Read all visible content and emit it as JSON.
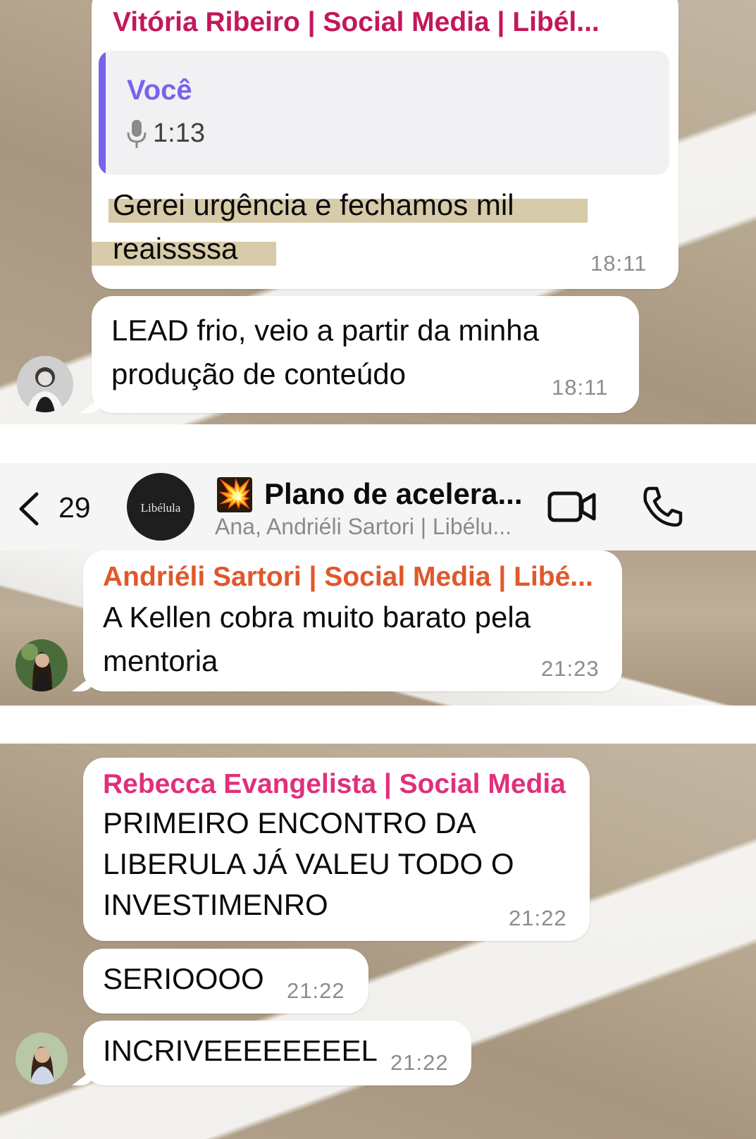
{
  "chat1": {
    "sender": "Vitória Ribeiro | Social Media | Libél...",
    "sender_color": "#c2185b",
    "reply": {
      "author": "Você",
      "author_color": "#7a63ea",
      "duration": "1:13",
      "icon": "microphone-icon"
    },
    "message": "Gerei urgência e fechamos mil\nreaissssa",
    "time": "18:11",
    "message2": "LEAD frio, veio a partir da minha\nprodução de conteúdo",
    "time2": "18:11"
  },
  "header": {
    "back_icon": "chevron-left-icon",
    "unread_count": "29",
    "group_avatar_text": "Libélula",
    "group_emoji": "💥",
    "title": "Plano de acelera...",
    "subtitle": "Ana, Andriéli Sartori | Libélu...",
    "video_icon": "video-camera-icon",
    "call_icon": "phone-icon"
  },
  "chat2": {
    "sender": "Andriéli Sartori | Social Media | Libé...",
    "sender_color": "#e0582b",
    "message": "A Kellen cobra muito barato pela\nmentoria",
    "time": "21:23"
  },
  "chat3": {
    "sender": "Rebecca Evangelista | Social Media",
    "sender_color": "#e0307a",
    "message": "PRIMEIRO ENCONTRO DA\nLIBERULA JÁ VALEU TODO O\nINVESTIMENRO",
    "time": "21:22",
    "message2": "SERIOOOO",
    "time2": "21:22",
    "message3": "INCRIVEEEEEEEEL",
    "time3": "21:22"
  }
}
